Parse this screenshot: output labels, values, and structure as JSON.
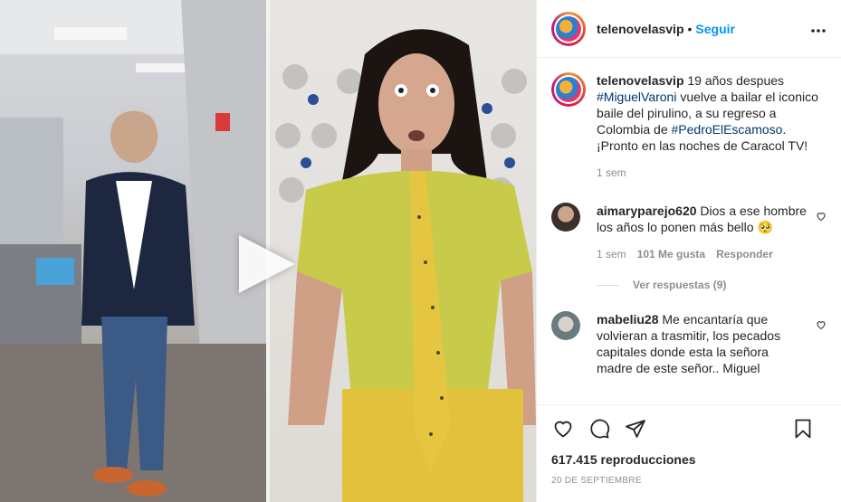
{
  "header": {
    "username": "telenovelasvip",
    "separator": "•",
    "follow_label": "Seguir",
    "more_icon": "more-horizontal-icon"
  },
  "caption": {
    "username": "telenovelasvip",
    "text_1": "19 años despues ",
    "hashtag_1": "#MiguelVaroni",
    "text_2": " vuelve a bailar el iconico baile del pirulino, a su regreso a Colombia de ",
    "hashtag_2": "#PedroElEscamoso",
    "text_3": ". ¡Pronto en las noches de Caracol TV!",
    "time": "1 sem"
  },
  "comments": [
    {
      "username": "aimaryparejo620",
      "text": "Dios a ese hombre los años lo ponen más bello 🥺",
      "time": "1 sem",
      "likes": "101 Me gusta",
      "reply_label": "Responder",
      "view_replies": "Ver respuestas (9)"
    },
    {
      "username": "mabeliu28",
      "text": "Me encantaría que volvieran a trasmitir, los pecados capitales donde esta la señora madre de este señor.. Miguel"
    }
  ],
  "footer": {
    "views": "617.415 reproducciones",
    "date": "20 DE SEPTIEMBRE"
  },
  "colors": {
    "follow": "#0095f6",
    "hashtag": "#00376b",
    "muted": "#8e8e8e"
  }
}
